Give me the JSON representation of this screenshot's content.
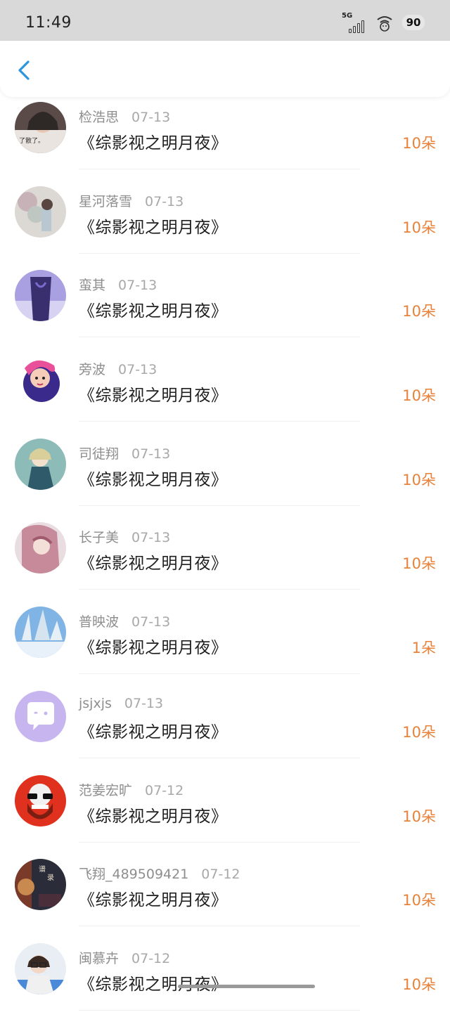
{
  "status_bar": {
    "time": "11:49",
    "network": "5G",
    "battery": "90"
  },
  "header": {
    "back_icon": "chevron-left-icon",
    "accent_color": "#2a96e0"
  },
  "colors": {
    "flower_count": "#e8823a",
    "username": "#8e8e8e",
    "title": "#1f1f1f"
  },
  "records": [
    {
      "user": "检浩思",
      "date": "07-13",
      "book": "《综影视之明月夜》",
      "flowers": "10朵",
      "avatar": "photo-dark-girl"
    },
    {
      "user": "星河落雪",
      "date": "07-13",
      "book": "《综影视之明月夜》",
      "flowers": "10朵",
      "avatar": "photo-flowers"
    },
    {
      "user": "蛮其",
      "date": "07-13",
      "book": "《综影视之明月夜》",
      "flowers": "10朵",
      "avatar": "illustration-purple"
    },
    {
      "user": "旁波",
      "date": "07-13",
      "book": "《综影视之明月夜》",
      "flowers": "10朵",
      "avatar": "cartoon-pink-hair"
    },
    {
      "user": "司徒翔",
      "date": "07-13",
      "book": "《综影视之明月夜》",
      "flowers": "10朵",
      "avatar": "anime-teal"
    },
    {
      "user": "长子美",
      "date": "07-13",
      "book": "《综影视之明月夜》",
      "flowers": "10朵",
      "avatar": "anime-pink"
    },
    {
      "user": "普映波",
      "date": "07-13",
      "book": "《综影视之明月夜》",
      "flowers": "1朵",
      "avatar": "photo-snow"
    },
    {
      "user": "jsjxjs",
      "date": "07-13",
      "book": "《综影视之明月夜》",
      "flowers": "10朵",
      "avatar": "default-chat-bubble"
    },
    {
      "user": "范姜宏旷",
      "date": "07-12",
      "book": "《综影视之明月夜》",
      "flowers": "10朵",
      "avatar": "skull-red"
    },
    {
      "user": "飞翔_489509421",
      "date": "07-12",
      "book": "《综影视之明月夜》",
      "flowers": "10朵",
      "avatar": "poster-dark"
    },
    {
      "user": "闽慕卉",
      "date": "07-12",
      "book": "《综影视之明月夜》",
      "flowers": "10朵",
      "avatar": "photo-glasses-girl"
    }
  ]
}
